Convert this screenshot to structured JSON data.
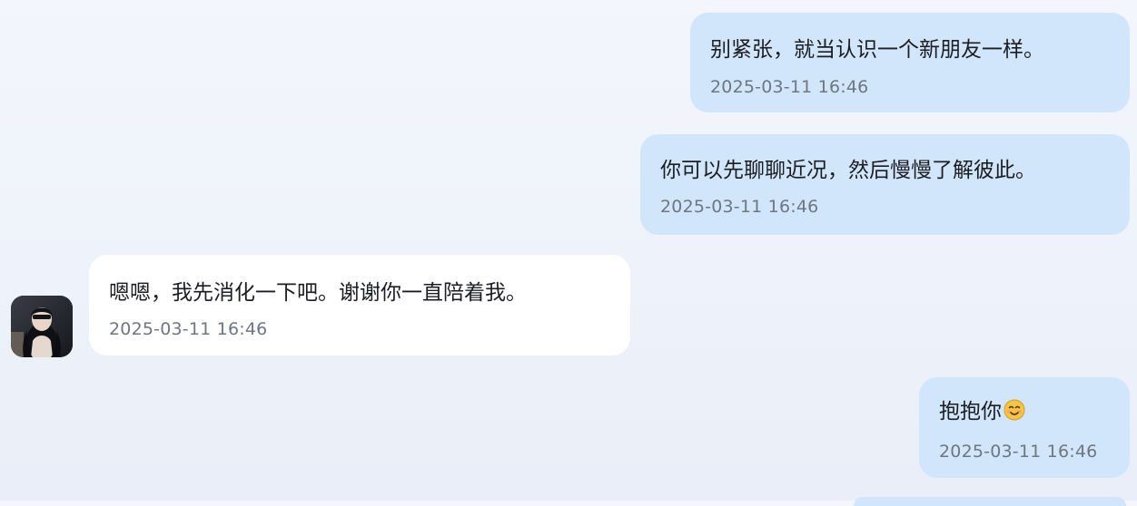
{
  "messages": [
    {
      "side": "sent",
      "text": "别紧张，就当认识一个新朋友一样。",
      "time": "2025-03-11 16:46"
    },
    {
      "side": "sent",
      "text": "你可以先聊聊近况，然后慢慢了解彼此。",
      "time": "2025-03-11 16:46"
    },
    {
      "side": "received",
      "text": "嗯嗯，我先消化一下吧。谢谢你一直陪着我。",
      "time": "2025-03-11 16:46"
    },
    {
      "side": "sent",
      "text": "抱抱你",
      "emoji": "smiling-face-icon",
      "time": "2025-03-11 16:46"
    }
  ],
  "contact": {
    "avatar_icon": "contact-avatar"
  },
  "colors": {
    "sent_bubble": "#d2e6fb",
    "received_bubble": "#ffffff",
    "timestamp": "#6e7682",
    "text": "#1b1d22"
  }
}
